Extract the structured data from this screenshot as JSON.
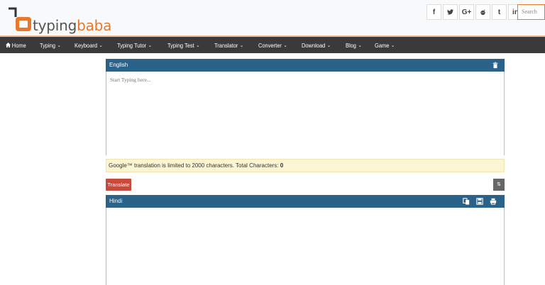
{
  "logo": {
    "part1": "typing",
    "part2": "baba",
    "accent_color": "#e8782b"
  },
  "social": [
    {
      "icon": "facebook-icon",
      "glyph": "f"
    },
    {
      "icon": "twitter-icon",
      "glyph": "♥"
    },
    {
      "icon": "google-plus-icon",
      "glyph": "G+"
    },
    {
      "icon": "reddit-icon",
      "glyph": "◉"
    },
    {
      "icon": "tumblr-icon",
      "glyph": "t"
    },
    {
      "icon": "linkedin-icon",
      "glyph": "in"
    }
  ],
  "search": {
    "placeholder": "Search"
  },
  "nav": {
    "home": "Home",
    "items": [
      "Typing",
      "Keyboard",
      "Typing Tutor",
      "Typing Test",
      "Translator",
      "Converter",
      "Download",
      "Blog",
      "Game"
    ]
  },
  "source": {
    "label": "English",
    "placeholder": "Start Typing here..."
  },
  "notice": {
    "text": "Google™ translation is limited to 2000 characters. Total Characters: ",
    "count": "0"
  },
  "translate_label": "Translate",
  "swap_label": "⇅",
  "target": {
    "label": "Hindi"
  },
  "colors": {
    "panel_header": "#2a6289",
    "nav_bg": "#3a3a3a",
    "notice_bg": "#fcf5d4",
    "translate_btn": "#c84a3c"
  }
}
